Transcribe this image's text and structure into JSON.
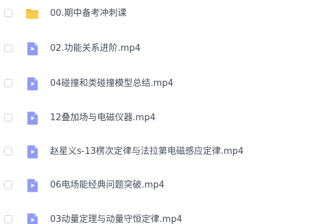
{
  "files": [
    {
      "name": "00.期中备考冲刺课",
      "type": "folder",
      "icon": "folder-icon"
    },
    {
      "name": "02.功能关系进阶.mp4",
      "type": "video",
      "icon": "video-file-icon"
    },
    {
      "name": "04碰撞和类碰撞模型总结.mp4",
      "type": "video",
      "icon": "video-file-icon"
    },
    {
      "name": "12叠加场与电磁仪器.mp4",
      "type": "video",
      "icon": "video-file-icon"
    },
    {
      "name": "赵星义s-13楞次定律与法拉第电磁感应定律.mp4",
      "type": "video",
      "icon": "video-file-icon"
    },
    {
      "name": "06电场能经典问题突破.mp4",
      "type": "video",
      "icon": "video-file-icon"
    },
    {
      "name": "03动量定理与动量守恒定律.mp4",
      "type": "video",
      "icon": "video-file-icon"
    }
  ],
  "colors": {
    "folder": "#f7c744",
    "video": "#8f9bf5",
    "text": "#454d5a",
    "checkbox_border": "#cfd3da"
  }
}
